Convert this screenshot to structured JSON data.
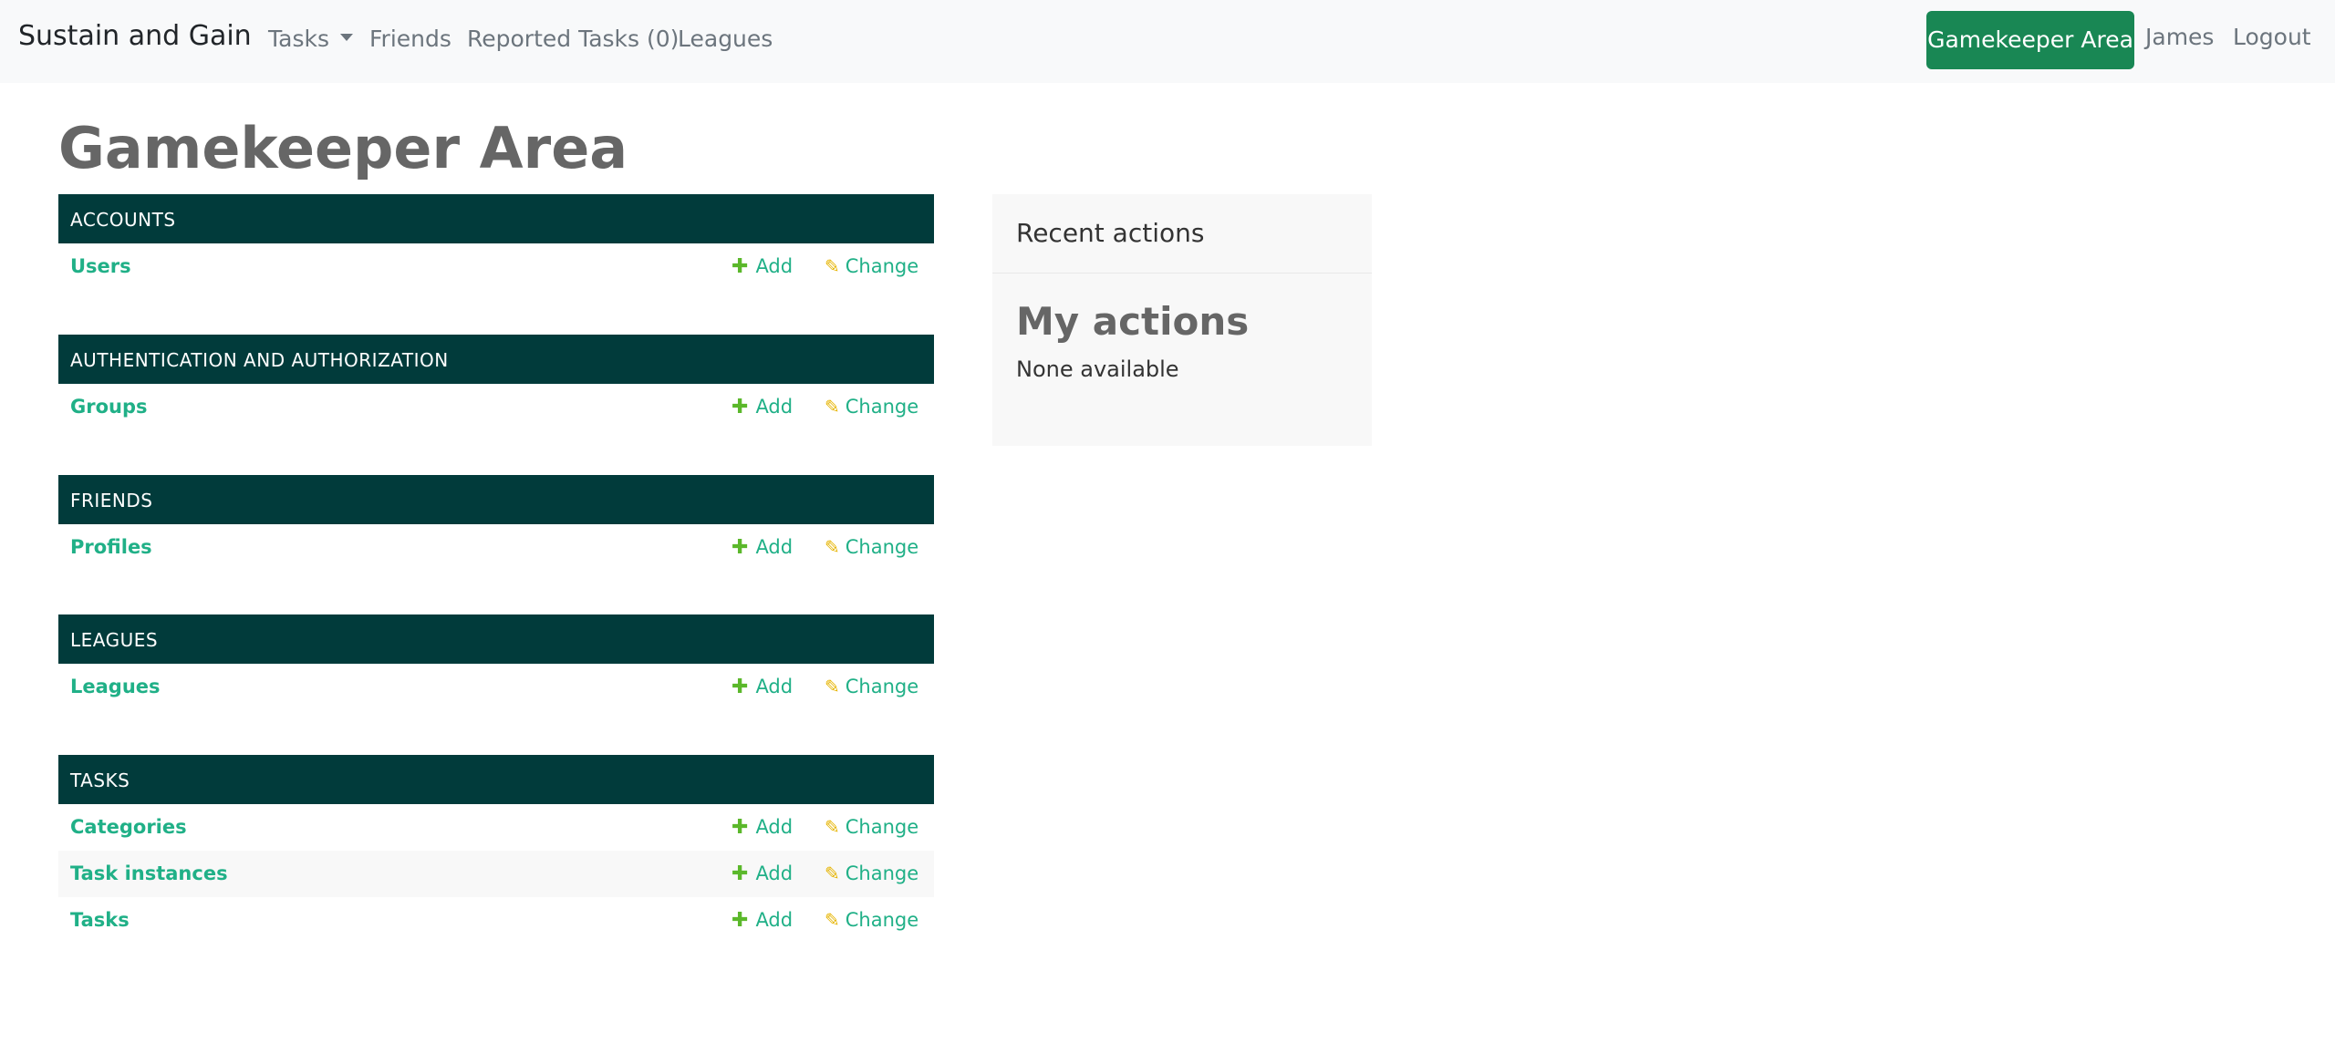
{
  "navbar": {
    "brand": "Sustain and Gain",
    "tasks": "Tasks",
    "friends": "Friends",
    "reported_tasks": "Reported Tasks (0)",
    "leagues": "Leagues",
    "gamekeeper_button": "Gamekeeper Area",
    "user": "James",
    "logout": "Logout"
  },
  "page": {
    "title": "Gamekeeper Area"
  },
  "common": {
    "add_label": "Add",
    "change_label": "Change"
  },
  "modules": [
    {
      "header": "ACCOUNTS",
      "models": [
        "Users"
      ]
    },
    {
      "header": "AUTHENTICATION AND AUTHORIZATION",
      "models": [
        "Groups"
      ]
    },
    {
      "header": "FRIENDS",
      "models": [
        "Profiles"
      ]
    },
    {
      "header": "LEAGUES",
      "models": [
        "Leagues"
      ]
    },
    {
      "header": "TASKS",
      "models": [
        "Categories",
        "Task instances",
        "Tasks"
      ]
    }
  ],
  "recent_actions": {
    "title": "Recent actions",
    "my_actions": "My actions",
    "empty": "None available"
  },
  "colors": {
    "navbar_bg": "#f8f9fa",
    "module_header_bg": "#013b3b",
    "link": "#20b087",
    "button_bg": "#198754",
    "add_icon": "#5bb82b",
    "change_icon": "#e6b400"
  },
  "icons": {
    "add": "plus-icon",
    "change": "pencil-icon",
    "dropdown": "chevron-down-icon"
  }
}
